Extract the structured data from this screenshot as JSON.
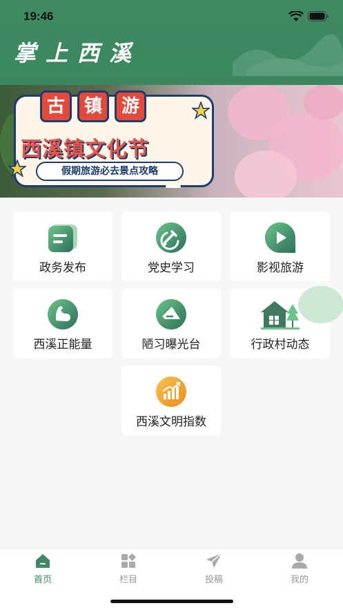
{
  "status_bar": {
    "time": "19:46"
  },
  "header": {
    "title": "掌上西溪"
  },
  "banner": {
    "tags": [
      "古",
      "镇",
      "游"
    ],
    "headline": "西溪镇文化节",
    "subtitle": "假期旅游必去景点攻略"
  },
  "menu": {
    "items": [
      {
        "label": "政务发布",
        "icon": "document-icon",
        "color": "#3f8a63"
      },
      {
        "label": "党史学习",
        "icon": "hammer-sickle-icon",
        "color": "#3f8a63"
      },
      {
        "label": "影视旅游",
        "icon": "play-icon",
        "color": "#3f8a63"
      },
      {
        "label": "西溪正能量",
        "icon": "strength-icon",
        "color": "#3f8a63"
      },
      {
        "label": "陋习曝光台",
        "icon": "announcement-icon",
        "color": "#3f8a63"
      },
      {
        "label": "行政村动态",
        "icon": "village-house-icon",
        "color": "#3f7a5e"
      },
      {
        "label": "西溪文明指数",
        "icon": "chart-up-icon",
        "color": "#f0a22a"
      }
    ]
  },
  "tabbar": {
    "tabs": [
      {
        "label": "首页",
        "icon": "home-icon",
        "active": true
      },
      {
        "label": "栏目",
        "icon": "columns-icon",
        "active": false
      },
      {
        "label": "投稿",
        "icon": "send-icon",
        "active": false
      },
      {
        "label": "我的",
        "icon": "user-icon",
        "active": false
      }
    ]
  }
}
